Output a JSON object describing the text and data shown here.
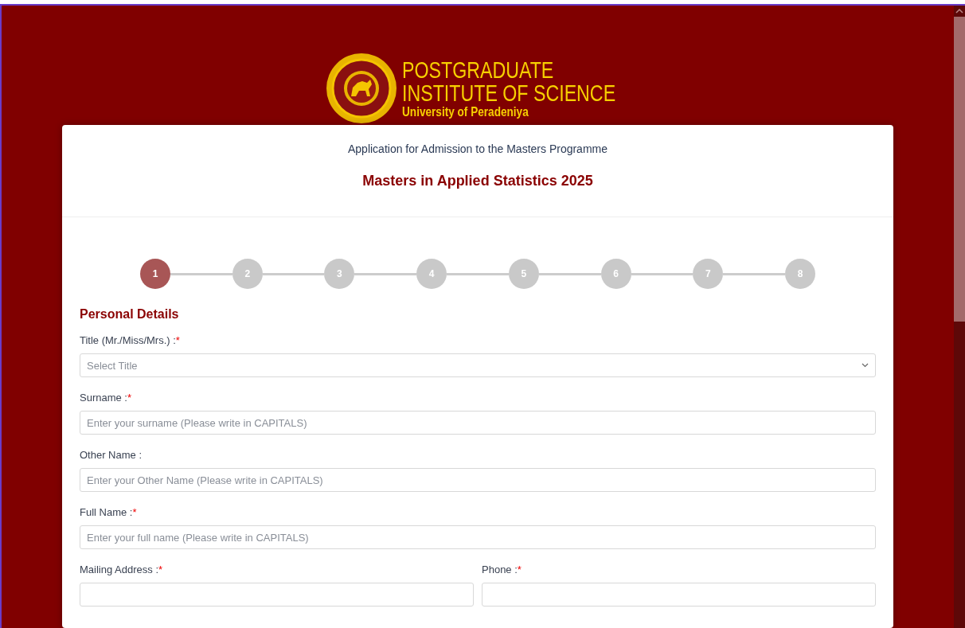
{
  "logo": {
    "line_1": "POSTGRADUATE",
    "line_2": "INSTITUTE OF SCIENCE",
    "line_3": "University of Peradeniya"
  },
  "header": {
    "subtitle": "Application for Admission to the Masters Programme",
    "title": "Masters in Applied Statistics 2025"
  },
  "steps": [
    {
      "label": "1",
      "selected": true
    },
    {
      "label": "2",
      "selected": false
    },
    {
      "label": "3",
      "selected": false
    },
    {
      "label": "4",
      "selected": false
    },
    {
      "label": "5",
      "selected": false
    },
    {
      "label": "6",
      "selected": false
    },
    {
      "label": "7",
      "selected": false
    },
    {
      "label": "8",
      "selected": false
    }
  ],
  "section_title": "Personal Details",
  "fields": [
    {
      "kind": "select",
      "label": "Title (Mr./Miss/Mrs.) :",
      "required": true,
      "placeholder": "Select Title"
    },
    {
      "kind": "text",
      "label": "Surname :",
      "required": true,
      "placeholder": "Enter your surname (Please write in CAPITALS)"
    },
    {
      "kind": "text",
      "label": "Other Name :",
      "required": false,
      "placeholder": "Enter your Other Name (Please write in CAPITALS)"
    },
    {
      "kind": "text",
      "label": "Full Name :",
      "required": true,
      "placeholder": "Enter your full name (Please write in CAPITALS)"
    }
  ],
  "row_fields": [
    {
      "kind": "text",
      "label": "Mailing Address :",
      "required": true
    },
    {
      "kind": "text",
      "label": "Phone :",
      "required": true
    }
  ],
  "required_mark": "*"
}
